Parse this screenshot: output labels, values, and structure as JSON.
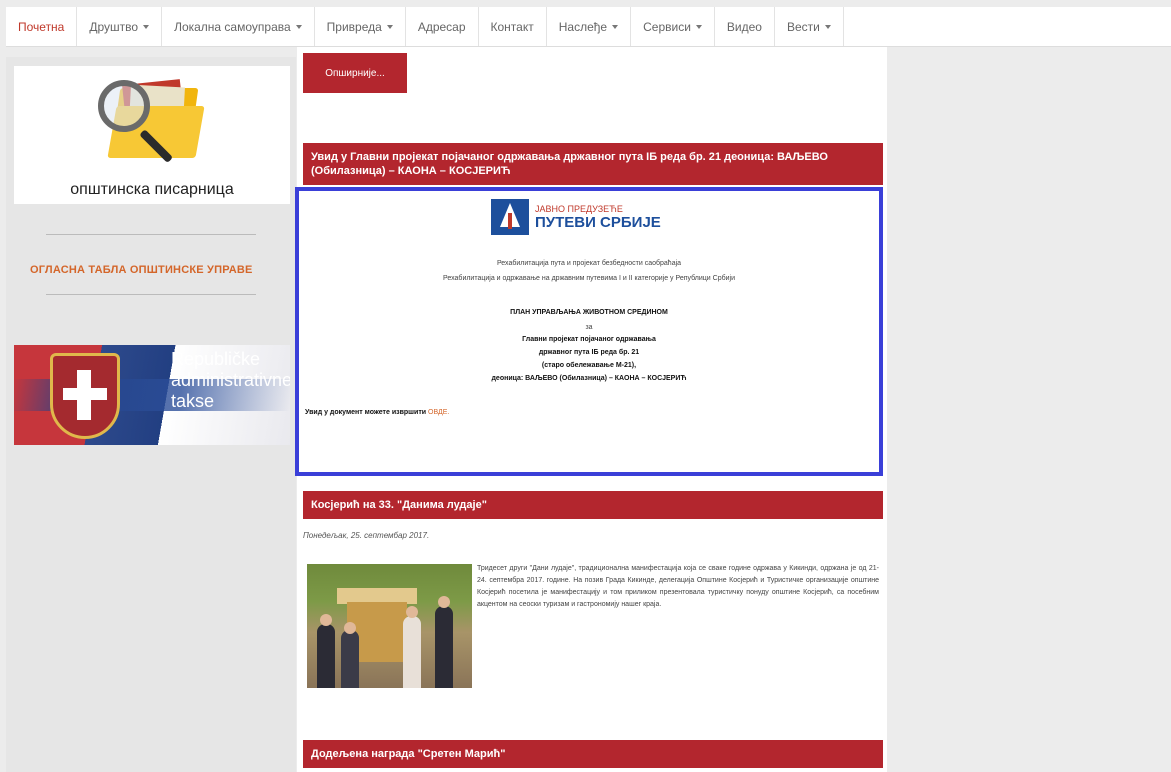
{
  "nav": {
    "items": [
      {
        "label": "Почетна",
        "active": true,
        "dropdown": false
      },
      {
        "label": "Друштво",
        "active": false,
        "dropdown": true
      },
      {
        "label": "Локална самоуправа",
        "active": false,
        "dropdown": true
      },
      {
        "label": "Привреда",
        "active": false,
        "dropdown": true
      },
      {
        "label": "Адресар",
        "active": false,
        "dropdown": false
      },
      {
        "label": "Контакт",
        "active": false,
        "dropdown": false
      },
      {
        "label": "Наслеђе",
        "active": false,
        "dropdown": true
      },
      {
        "label": "Сервиси",
        "active": false,
        "dropdown": true
      },
      {
        "label": "Видео",
        "active": false,
        "dropdown": false
      },
      {
        "label": "Вести",
        "active": false,
        "dropdown": true
      }
    ]
  },
  "sidebar": {
    "pisarnica_title": "општинска писарница",
    "oglasna_tabla": "ОГЛАСНА ТАБЛА ОПШТИНСКЕ УПРАВЕ",
    "rat_banner": {
      "line1": "Republičke",
      "line2": "administrativne",
      "line3": "takse"
    }
  },
  "main": {
    "opsirnije_label": "Опширније...",
    "article1": {
      "title": "Увид у Главни пројекат појачаног одржавања државног пута IБ реда бр. 21 деоница: ВАЉЕВО (Обилазница) – КАОНА – КОСЈЕРИЋ",
      "logo_line1": "ЈАВНО ПРЕДУЗЕЋЕ",
      "logo_line2": "ПУТЕВИ СРБИЈЕ",
      "doc_line1": "Рехабилитација пута и пројекат безбедности саобраћаја",
      "doc_line2": "Рехабилитација и одржавање на државним путевима I и II категорије у Републици Србији",
      "plan_title": "ПЛАН УПРАВЉАЊА ЖИВОТНОМ СРЕДИНОМ",
      "plan_za": "за",
      "plan_l1": "Главни пројекат појачаног одржавања",
      "plan_l2": "државног пута IБ реда бр. 21",
      "plan_l3": "(старо обележавање М-21),",
      "plan_l4": "деоница: ВАЉЕВО (Обилазница) – КАОНА – КОСЈЕРИЋ",
      "uvid_text": "Увид у документ можете извршити",
      "uvid_link": "ОВДЕ."
    },
    "article2": {
      "title": "Косјерић на 33. \"Данима лудаје\"",
      "date": "Понедељак, 25. септембар 2017.",
      "body": "Тридесет други \"Дани лудаје\", традиционална манифестација која се сваке године одржава у Кикинди, одржана је од 21-24. септембра 2017. године. На позив Града Кикинде, делегација Општине Косјерић и Туристичке организације општине Косјерић посетила је манифестацију и том приликом презентовала туристичку понуду општине Косјерић, са посебним акцентом на сеоски туризам и гастрономију нашег краја."
    },
    "article3": {
      "title": "Додељена награда \"Сретен Марић\""
    }
  },
  "colors": {
    "accent": "#b3262e",
    "highlight_border": "#3a3fd8",
    "link": "#d4662a"
  }
}
